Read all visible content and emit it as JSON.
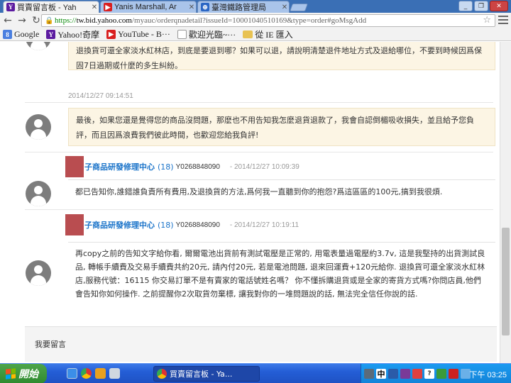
{
  "browser": {
    "tabs": [
      {
        "label": "買賣留言板 - Yah",
        "favicon_text": "Y",
        "favicon_color": "#5c1ba0",
        "active": true
      },
      {
        "label": "Yanis Marshall, Ar",
        "favicon_text": "▶",
        "favicon_color": "#d91f1f",
        "active": false
      },
      {
        "label": "臺灣鐵路管理局",
        "favicon_text": "⊕",
        "favicon_color": "#2a66c4",
        "active": false
      }
    ],
    "url_scheme": "https://",
    "url_host": "tw.bid.yahoo.com",
    "url_path": "/myauc/orderqnadetail?issueId=10001040510169&type=order#goMsgAdd",
    "bookmarks": [
      {
        "label": "Google",
        "icon": "8",
        "color": "#4a7fe0"
      },
      {
        "label": "Yahoo!奇摩",
        "icon": "Y",
        "color": "#5c1ba0"
      },
      {
        "label": "YouTube - B···",
        "icon": "▶",
        "color": "#d91f1f"
      },
      {
        "label": "歡迎光臨~···",
        "icon": "",
        "color": "#ffffff"
      },
      {
        "label": "從 IE 匯入",
        "icon": "",
        "color": "#e8c252"
      }
    ]
  },
  "thread": {
    "top_reply": {
      "text": "退換貨可還全家淡水紅林店，到底是要退到哪？如果可以退，請說明清楚退件地址方式及退給哪位，不要到時候因爲保固7日過期或什麼的多生糾紛。"
    },
    "timestamp_1": "2014/12/27 09:14:51",
    "reply_2": {
      "text": "最後，如果您還是覺得您的商品沒問題，那麽也不用告知我怎麼退貨退款了，我會自認倒楣吸收損失，並且給予您負評，而且因爲浪費我們彼此時間，也歡迎您給我負評!"
    },
    "seller_msg_1": {
      "name": "子商品研發修理中心",
      "score": "(18)",
      "id": "Y0268848090",
      "time": "- 2014/12/27 10:09:39",
      "text": "都已告知你,誰錯誰負責所有費用,及退換貨的方法,爲何我一直聽到你的抱怨?爲這區區的100元,搞到我很煩."
    },
    "seller_msg_2": {
      "name": "子商品研發修理中心",
      "score": "(18)",
      "id": "Y0268848090",
      "time": "- 2014/12/27 10:19:11",
      "text": "再copy之前的告知文字給你看, 爾爾電池出貨前有測試電壓是正常的, 用電表量過電壓約3.7v, 這是我堅持的出貨測試良品, 轉帳手續費及交易手續費共約20元, 請內付20元, 若是電池問題, 退來回運費+120元給你. 退換貨可還全家淡水紅林店,服務代號：16115 你交易訂單不是有賣家的電話號姓名嗎？ 你不懂拆購退貨或是全家的寄貨方式嗎?你問店員,他們會告知你如何操作. 之前提醒你2次取貨勿棄標, 讓我對你的一堆問題說的話, 無法完全信任你說的話."
    },
    "leave_message_label": "我要留言"
  },
  "taskbar": {
    "start_label": "開始",
    "active_window": "買賣留言板 - Ya...",
    "ime": "中",
    "clock": "下午 03:25"
  },
  "colors": {
    "link_blue": "#1a73c9",
    "reply_bg": "#fcf5e4",
    "seller_thumb": "#b94d50",
    "taskbar_blue": "#245ed6",
    "start_green": "#2f8a2e"
  }
}
